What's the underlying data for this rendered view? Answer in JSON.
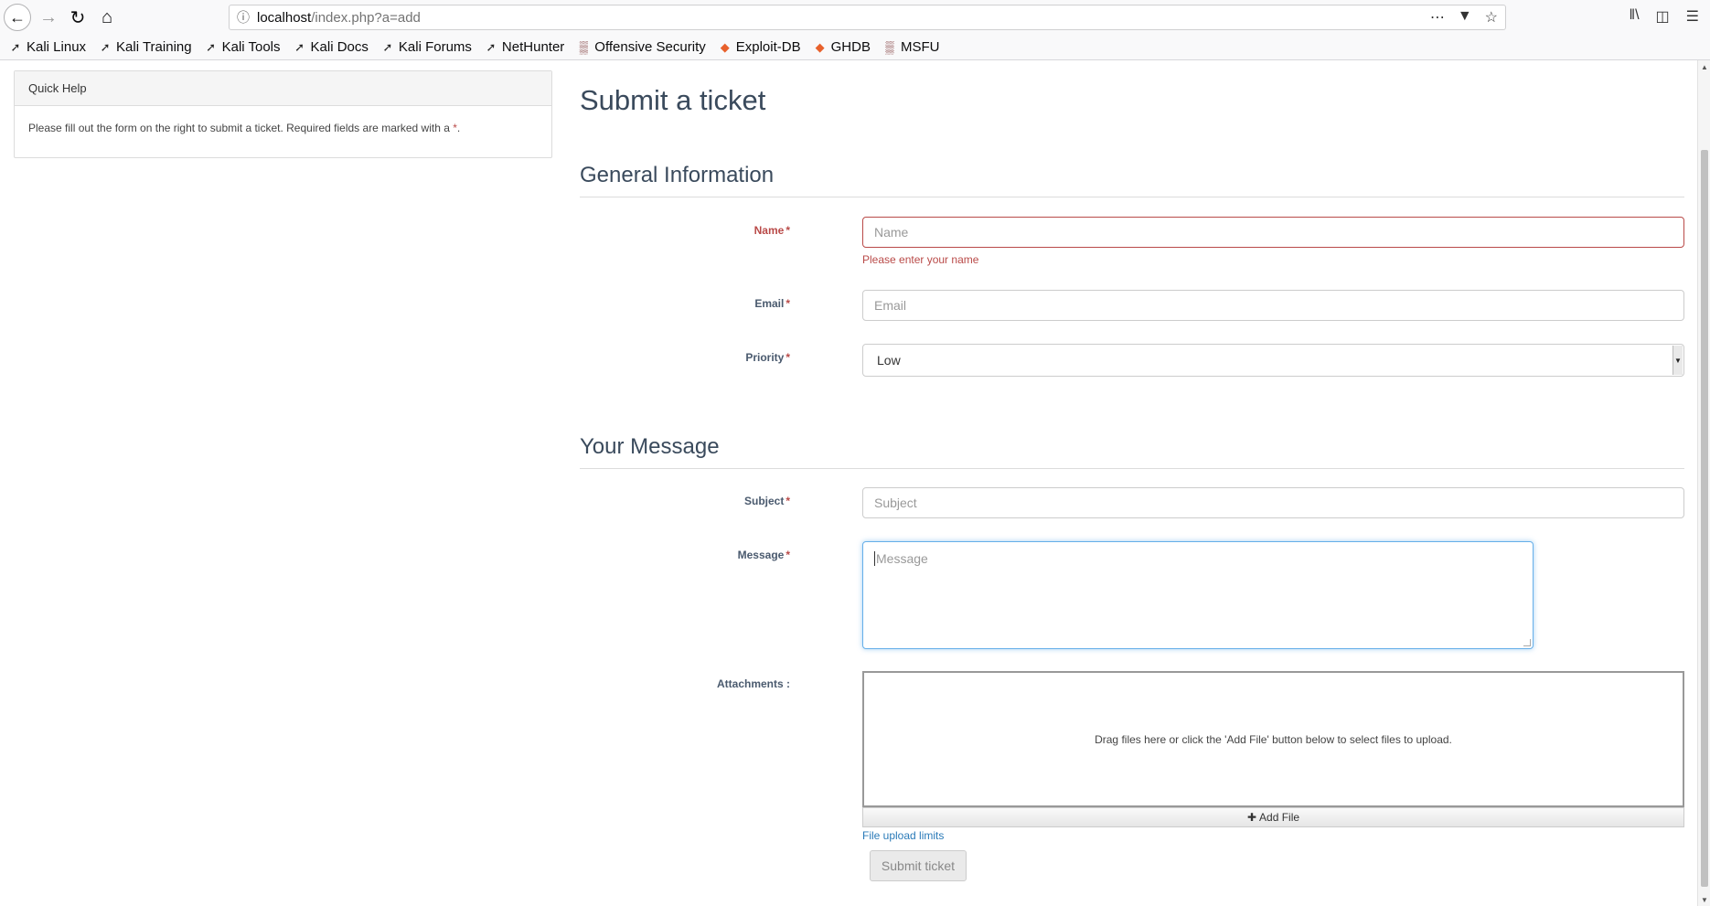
{
  "browser": {
    "url_host": "localhost",
    "url_path": "/index.php?a=add",
    "bookmarks": [
      {
        "label": "Kali Linux",
        "icon": "kali-dragon-icon"
      },
      {
        "label": "Kali Training",
        "icon": "kali-dragon-icon"
      },
      {
        "label": "Kali Tools",
        "icon": "kali-dragon-icon"
      },
      {
        "label": "Kali Docs",
        "icon": "kali-dragon-icon"
      },
      {
        "label": "Kali Forums",
        "icon": "kali-dragon-icon"
      },
      {
        "label": "NetHunter",
        "icon": "kali-dragon-icon"
      },
      {
        "label": "Offensive Security",
        "icon": "offsec-icon"
      },
      {
        "label": "Exploit-DB",
        "icon": "exploitdb-icon"
      },
      {
        "label": "GHDB",
        "icon": "exploitdb-icon"
      },
      {
        "label": "MSFU",
        "icon": "offsec-icon"
      }
    ]
  },
  "quick_help": {
    "title": "Quick Help",
    "text": "Please fill out the form on the right to submit a ticket. Required fields are marked with a",
    "star": "*",
    "period": "."
  },
  "form": {
    "page_title": "Submit a ticket",
    "section_general": "General Information",
    "section_message": "Your Message",
    "required_marker": "*",
    "name": {
      "label": "Name",
      "placeholder": "Name",
      "error": "Please enter your name"
    },
    "email": {
      "label": "Email",
      "placeholder": "Email"
    },
    "priority": {
      "label": "Priority",
      "value": "Low"
    },
    "subject": {
      "label": "Subject",
      "placeholder": "Subject"
    },
    "message": {
      "label": "Message",
      "placeholder": "Message"
    },
    "attachments": {
      "label": "Attachments :",
      "dropzone_text": "Drag files here or click the 'Add File' button below to select files to upload.",
      "add_file_label": "Add File",
      "limits_link": "File upload limits"
    },
    "submit_label": "Submit ticket"
  },
  "colors": {
    "error": "#b94a48",
    "heading": "#3a4a5c",
    "focus": "#66afe9",
    "link": "#2a7ab8"
  }
}
